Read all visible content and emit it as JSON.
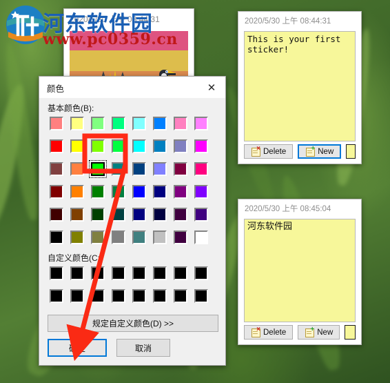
{
  "desktop": {
    "wallpaper_description": "blurred green grass",
    "colors": {
      "green_dark": "#2f5220",
      "green_mid": "#4f7a32",
      "green_light": "#78a546"
    }
  },
  "watermark": {
    "site_name": "河东软件园",
    "url": "www.pc0359.cn",
    "logo_name": "hedong-logo",
    "brand_blue": "#1a5fb4",
    "brand_red": "#c01818"
  },
  "pixel_window": {
    "timestamp": "2020/5/30 上午 08:44:31",
    "art": {
      "band_top": "#de5380",
      "band_mid": "#ddbd4c",
      "band_bottom": "#d98a4e",
      "bird": "penguin-sprite"
    }
  },
  "notes": [
    {
      "timestamp": "2020/5/30 上午 08:44:31",
      "text": "This is your first\nsticker!",
      "color": "#f7f79a",
      "delete_label": "Delete",
      "new_label": "New",
      "new_focused": true
    },
    {
      "timestamp": "2020/5/30 上午 08:45:04",
      "text": "河东软件园",
      "color": "#f7f79a",
      "delete_label": "Delete",
      "new_label": "New",
      "new_focused": false
    }
  ],
  "color_dialog": {
    "title": "颜色",
    "close_icon": "close-icon",
    "basic_label": "基本颜色(B):",
    "custom_label": "自定义颜色(C:",
    "define_custom_label": "规定自定义颜色(D)  >>",
    "ok_label": "确定",
    "cancel_label": "取消",
    "selected_index": 18,
    "selected_color": "#80ff00",
    "basic_colors": [
      "#ff8080",
      "#ffff80",
      "#80ff80",
      "#00ff80",
      "#80ffff",
      "#0080ff",
      "#ff80c0",
      "#ff80ff",
      "#ff0000",
      "#ffff00",
      "#80ff00",
      "#00ff40",
      "#00ffff",
      "#0080c0",
      "#8080c0",
      "#ff00ff",
      "#804040",
      "#ff8040",
      "#00ff00",
      "#008080",
      "#004080",
      "#8080ff",
      "#800040",
      "#ff0080",
      "#800000",
      "#ff8000",
      "#008000",
      "#008040",
      "#0000ff",
      "#000080",
      "#800080",
      "#8000ff",
      "#400000",
      "#804000",
      "#004000",
      "#004040",
      "#000080",
      "#000040",
      "#400040",
      "#400080",
      "#000000",
      "#808000",
      "#808040",
      "#808080",
      "#408080",
      "#c0c0c0",
      "#400040",
      "#ffffff"
    ],
    "custom_colors": [
      "#000000",
      "#000000",
      "#000000",
      "#000000",
      "#000000",
      "#000000",
      "#000000",
      "#000000",
      "#000000",
      "#000000",
      "#000000",
      "#000000",
      "#000000",
      "#000000",
      "#000000",
      "#000000"
    ]
  },
  "annotations": {
    "highlight_box_color": "#ff2a16",
    "arrow_color": "#fa2a14",
    "highlight_target": "selected-color-swatch",
    "arrow_target": "ok-button"
  }
}
